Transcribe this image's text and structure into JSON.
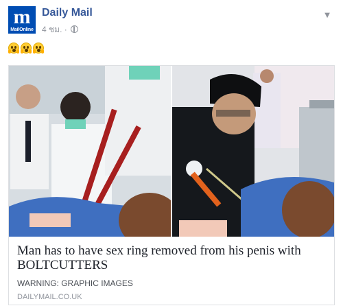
{
  "post": {
    "page_name": "Daily Mail",
    "logo_letter": "m",
    "logo_sub": "MailOnline",
    "timestamp": "4 ชม.",
    "separator": "·",
    "privacy_icon": "globe-icon",
    "menu_icon": "chevron-down-icon",
    "emojis": [
      "screaming-face-emoji",
      "screaming-face-emoji",
      "screaming-face-emoji"
    ]
  },
  "link_card": {
    "title": "Man has to have sex ring removed from his penis with BOLTCUTTERS",
    "description": "WARNING: GRAPHIC IMAGES",
    "domain": "DAILYMAIL.CO.UK"
  },
  "colors": {
    "brand": "#004db3",
    "link": "#365899",
    "meta": "#90949c"
  }
}
